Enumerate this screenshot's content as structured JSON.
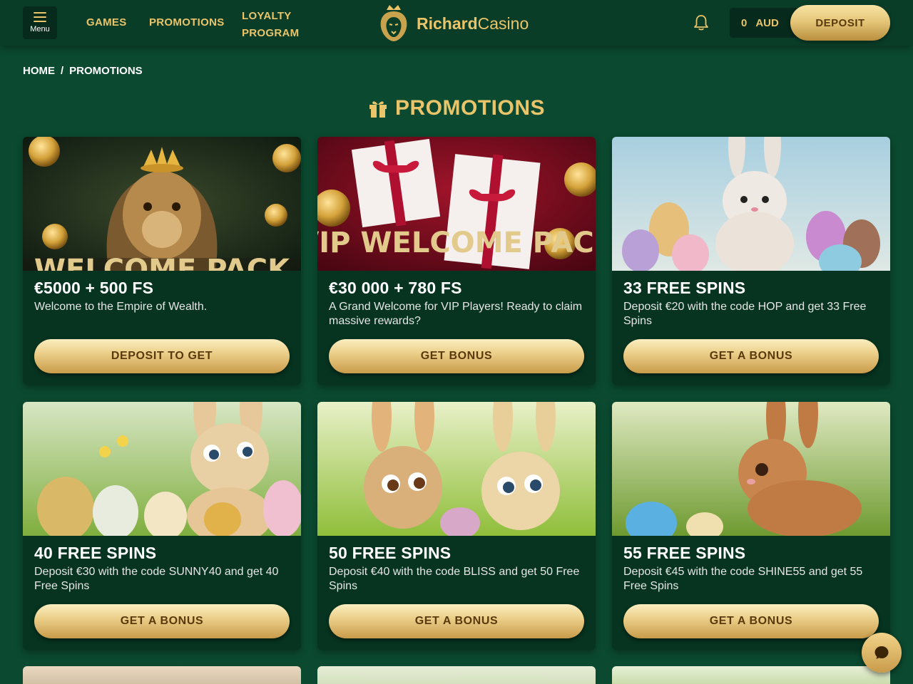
{
  "header": {
    "menu_label": "Menu",
    "nav": [
      "GAMES",
      "PROMOTIONS",
      "LOYALTY PROGRAM"
    ],
    "logo_bold": "Richard",
    "logo_light": "Casino",
    "balance_amount": "0",
    "balance_currency": "AUD",
    "deposit_label": "DEPOSIT"
  },
  "breadcrumb": {
    "home": "HOME",
    "sep": "/",
    "current": "PROMOTIONS"
  },
  "page_title": "PROMOTIONS",
  "promotions": [
    {
      "image_text": "WELCOME PACK",
      "title": "€5000 + 500 FS",
      "description": "Welcome to the Empire of Wealth.",
      "button": "DEPOSIT TO GET"
    },
    {
      "image_text": "VIP WELCOME PACK",
      "title": "€30 000 + 780 FS",
      "description": "A Grand Welcome for VIP Players! Ready to claim massive rewards?",
      "button": "GET BONUS"
    },
    {
      "title": "33 FREE SPINS",
      "description": "Deposit €20 with the code HOP and get 33 Free Spins",
      "button": "GET A BONUS"
    },
    {
      "title": "40 FREE SPINS",
      "description": "Deposit €30 with the code SUNNY40 and get 40 Free Spins",
      "button": "GET A BONUS"
    },
    {
      "title": "50 FREE SPINS",
      "description": "Deposit €40 with the code BLISS and get 50 Free Spins",
      "button": "GET A BONUS"
    },
    {
      "title": "55 FREE SPINS",
      "description": "Deposit €45 with the code SHINE55 and get 55 Free Spins",
      "button": "GET A BONUS"
    }
  ],
  "colors": {
    "background": "#0b4a30",
    "header": "#0a3d28",
    "gold": "#e9c46a",
    "card": "#063420"
  },
  "icons": [
    "hamburger-icon",
    "logo-lion-icon",
    "bell-icon",
    "gift-icon",
    "chat-icon"
  ]
}
